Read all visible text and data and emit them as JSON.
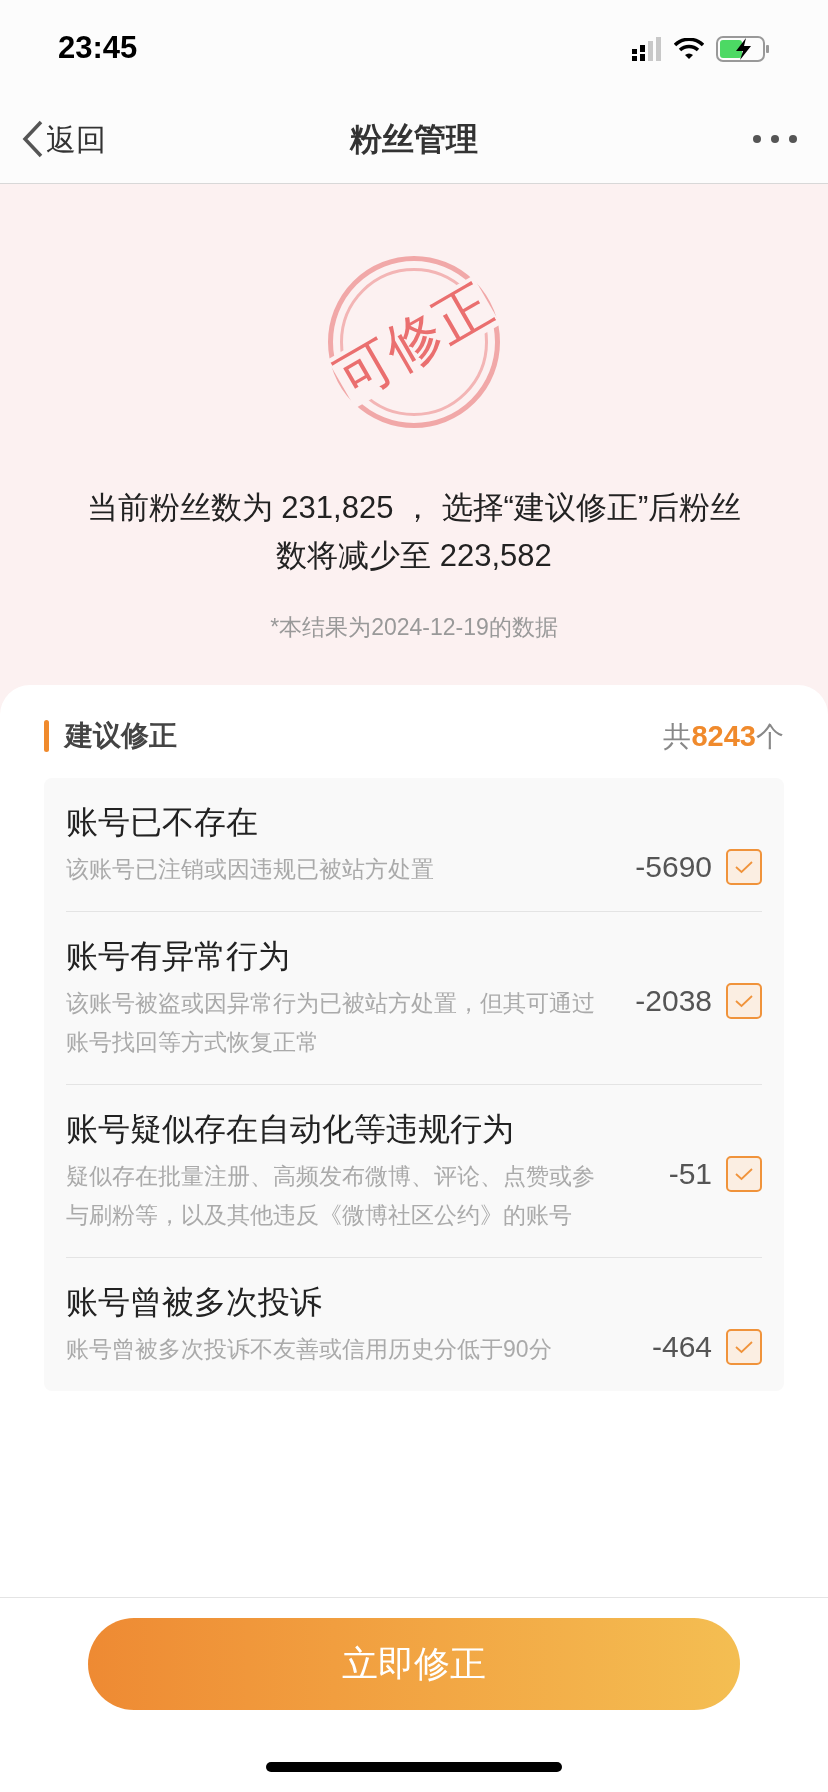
{
  "status_bar": {
    "time": "23:45"
  },
  "nav": {
    "back_label": "返回",
    "title": "粉丝管理"
  },
  "stamp": {
    "text": "可修正"
  },
  "summary": "当前粉丝数为 231,825 ， 选择“建议修正”后粉丝数将减少至 223,582",
  "date_note": "*本结果为2024-12-19的数据",
  "section": {
    "title": "建议修正",
    "total_prefix": "共",
    "total": "8243",
    "total_suffix": "个"
  },
  "items": [
    {
      "title": "账号已不存在",
      "description": "该账号已注销或因违规已被站方处置",
      "count": "-5690",
      "checked": true
    },
    {
      "title": "账号有异常行为",
      "description": "该账号被盗或因异常行为已被站方处置，但其可通过账号找回等方式恢复正常",
      "count": "-2038",
      "checked": true
    },
    {
      "title": "账号疑似存在自动化等违规行为",
      "description": "疑似存在批量注册、高频发布微博、评论、点赞或参与刷粉等，以及其他违反《微博社区公约》的账号",
      "count": "-51",
      "checked": true
    },
    {
      "title": "账号曾被多次投诉",
      "description": "账号曾被多次投诉不友善或信用历史分低于90分",
      "count": "-464",
      "checked": true
    }
  ],
  "action_button": "立即修正"
}
